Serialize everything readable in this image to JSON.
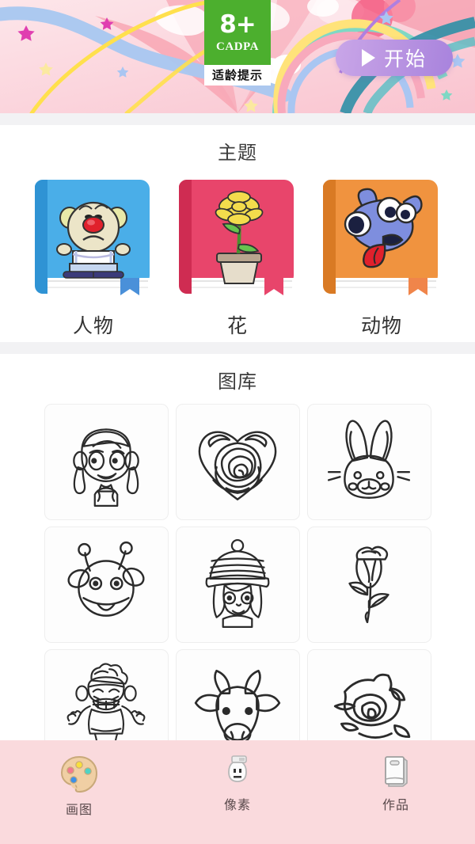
{
  "banner": {
    "rating_badge": {
      "age": "8+",
      "org": "CADPA",
      "hint": "适龄提示",
      "green": "#4caf2e"
    },
    "start_button": {
      "label": "开始",
      "icon": "play-icon",
      "color": "#b291e0"
    },
    "background_colors": [
      "#fcd6dd",
      "#f9a7b5",
      "#9fc3f0",
      "#ffe14d",
      "#3fb6a8",
      "#2f8fa8"
    ]
  },
  "theme_section": {
    "title": "主题",
    "items": [
      {
        "label": "人物",
        "cover": "clown-book-cover",
        "color": "#4aaee8",
        "spine": "#2f93d4",
        "ribbon": "#4a90d9"
      },
      {
        "label": "花",
        "cover": "flower-pot-book-cover",
        "color": "#e8456b",
        "spine": "#cf2c52",
        "ribbon": "#e8456b"
      },
      {
        "label": "动物",
        "cover": "dog-book-cover",
        "color": "#f0933f",
        "spine": "#d97a24",
        "ribbon": "#f0854a"
      }
    ]
  },
  "gallery_section": {
    "title": "图库",
    "items": [
      {
        "name": "girl-with-pigtails"
      },
      {
        "name": "heart-rose"
      },
      {
        "name": "bunny-head"
      },
      {
        "name": "giraffe-head"
      },
      {
        "name": "girl-with-winter-hat"
      },
      {
        "name": "rose-with-stem"
      },
      {
        "name": "monkey-boy"
      },
      {
        "name": "cow-head"
      },
      {
        "name": "rose-bloom"
      }
    ]
  },
  "bottom_nav": {
    "background": "#fadadd",
    "items": [
      {
        "label": "画图",
        "icon": "palette-icon",
        "active": true
      },
      {
        "label": "像素",
        "icon": "pixel-character-icon",
        "active": false
      },
      {
        "label": "作品",
        "icon": "book-icon",
        "active": false
      }
    ]
  }
}
